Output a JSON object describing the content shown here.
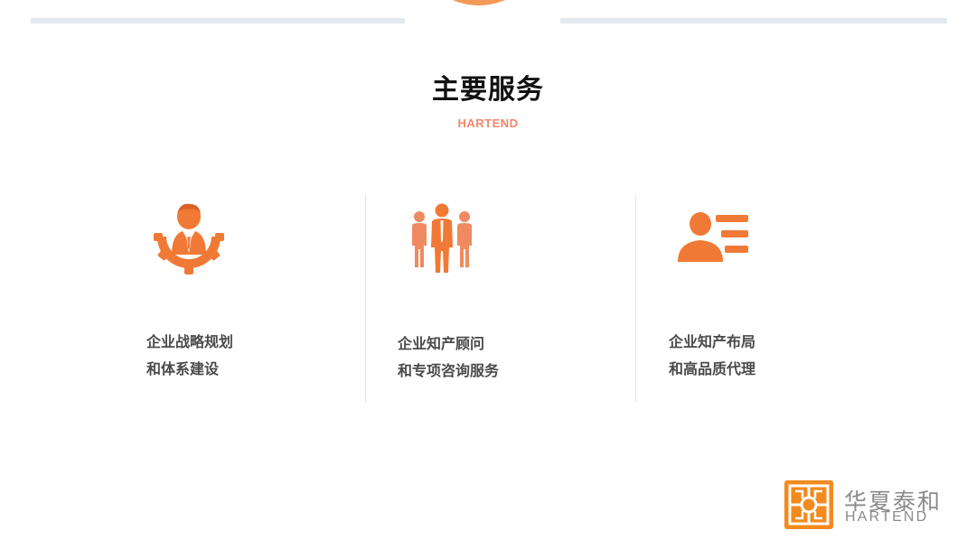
{
  "header": {
    "title": "主要服务",
    "subtitle": "HARTEND"
  },
  "colors": {
    "accent": "#f07a35",
    "accent_light": "#f0876a",
    "arc": "#f29a55",
    "rule": "#e4e9f0",
    "text": "#4a4a4a"
  },
  "services": [
    {
      "icon": "gear-person-icon",
      "line1": "企业战略规划",
      "line2": "和体系建设"
    },
    {
      "icon": "team-icon",
      "line1": "企业知产顾问",
      "line2": "和专项咨询服务"
    },
    {
      "icon": "person-list-icon",
      "line1": "企业知产布局",
      "line2": "和高品质代理"
    }
  ],
  "logo": {
    "cn": "华夏泰和",
    "en": "HARTEND"
  }
}
